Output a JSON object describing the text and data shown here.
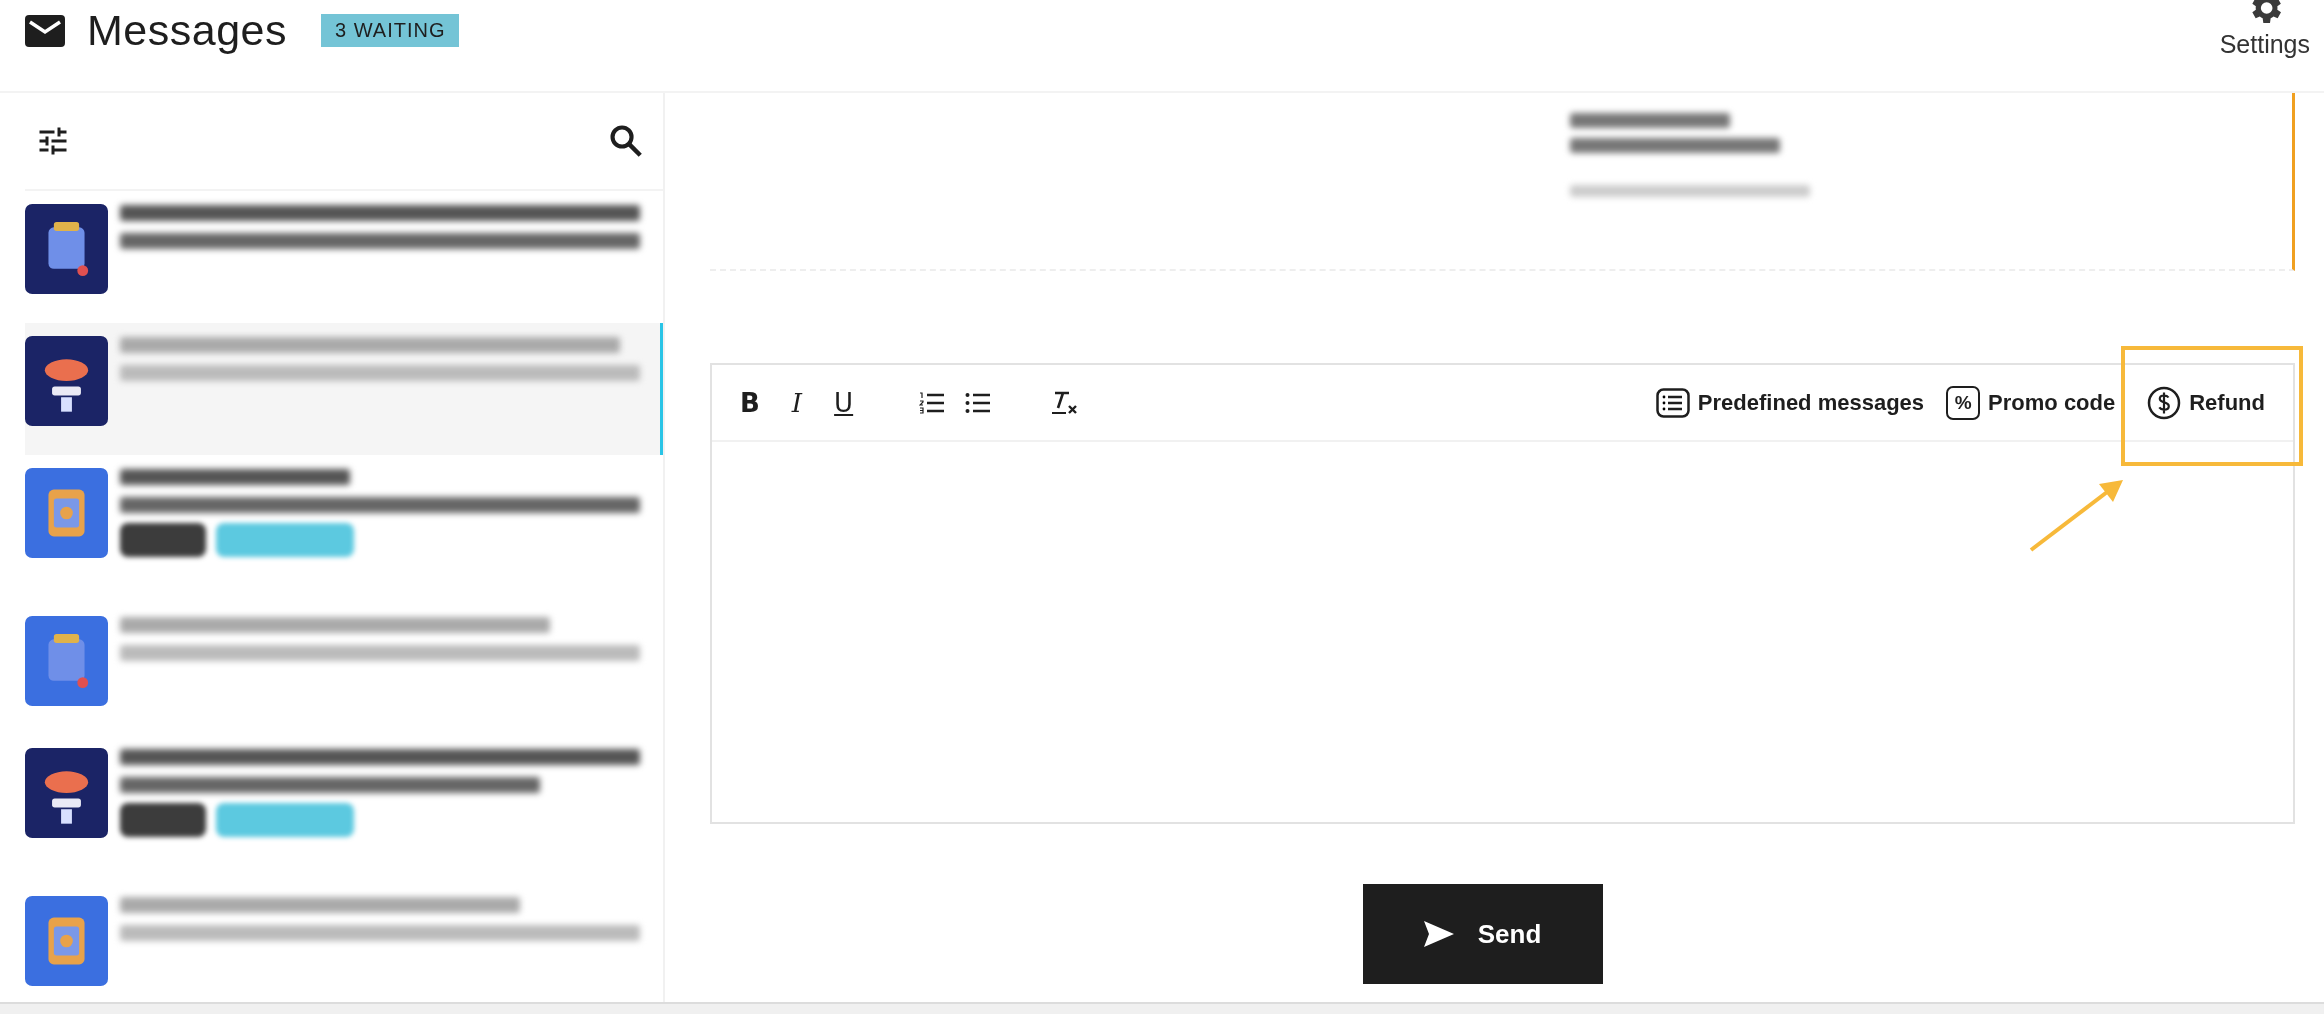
{
  "header": {
    "title": "Messages",
    "badge": "3 WAITING",
    "settings_label": "Settings"
  },
  "conversations": [
    {
      "selected": false,
      "tagged": false,
      "color": "#1b2466"
    },
    {
      "selected": true,
      "tagged": false,
      "color": "#1b2466"
    },
    {
      "selected": false,
      "tagged": true,
      "color": "#3b6fe0"
    },
    {
      "selected": false,
      "tagged": false,
      "color": "#3b6fe0"
    },
    {
      "selected": false,
      "tagged": true,
      "color": "#1b2466"
    },
    {
      "selected": false,
      "tagged": false,
      "color": "#3b6fe0"
    }
  ],
  "editor": {
    "format_buttons": [
      {
        "kind": "bold",
        "label": "B"
      },
      {
        "kind": "italic",
        "label": "I"
      },
      {
        "kind": "underline",
        "label": "U"
      },
      {
        "kind": "ordered-list"
      },
      {
        "kind": "bullet-list"
      },
      {
        "kind": "clear-format"
      }
    ],
    "actions": [
      {
        "kind": "predefined",
        "label": "Predefined messages",
        "highlighted": false
      },
      {
        "kind": "promo",
        "label": "Promo code",
        "icon_text": "%",
        "highlighted": false
      },
      {
        "kind": "refund",
        "label": "Refund",
        "highlighted": true
      }
    ]
  },
  "send": {
    "label": "Send"
  }
}
